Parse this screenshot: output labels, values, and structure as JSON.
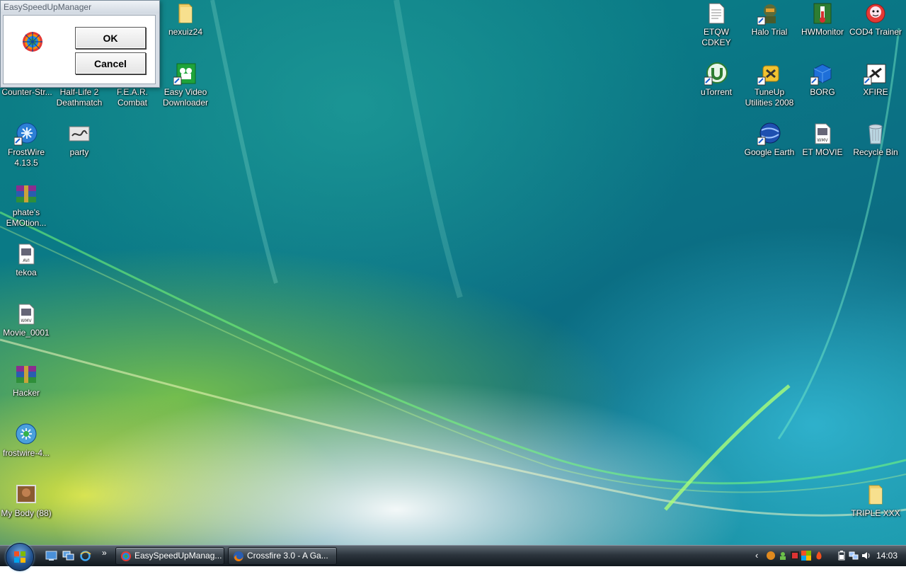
{
  "dialog": {
    "title": "EasySpeedUpManager",
    "ok_label": "OK",
    "cancel_label": "Cancel"
  },
  "desktop": {
    "left_icons": [
      {
        "label": "nexuiz24",
        "icon": "folder-icon"
      },
      {
        "label": "Counter-Str...",
        "icon": "game-icon"
      },
      {
        "label": "Half-Life 2 Deathmatch",
        "icon": "game-icon"
      },
      {
        "label": "F.E.A.R. Combat",
        "icon": "game-icon"
      },
      {
        "label": "Easy Video Downloader",
        "icon": "video-downloader-icon"
      },
      {
        "label": "FrostWire 4.13.5",
        "icon": "frostwire-icon"
      },
      {
        "label": "party",
        "icon": "image-file-icon"
      },
      {
        "label": "phate's EMOtion...",
        "icon": "winrar-archive-icon"
      },
      {
        "label": "tekoa",
        "icon": "avi-file-icon"
      },
      {
        "label": "Movie_0001",
        "icon": "wmv-file-icon"
      },
      {
        "label": "Hacker",
        "icon": "winrar-archive-icon"
      },
      {
        "label": "frostwire-4...",
        "icon": "frostwire-icon"
      },
      {
        "label": "My Body (88)",
        "icon": "photo-thumbnail-icon"
      }
    ],
    "right_icons": [
      {
        "label": "ETQW CDKEY",
        "icon": "text-document-icon"
      },
      {
        "label": "Halo Trial",
        "icon": "halo-icon"
      },
      {
        "label": "HWMonitor",
        "icon": "hwmonitor-icon"
      },
      {
        "label": "COD4 Trainer",
        "icon": "trainer-icon"
      },
      {
        "label": "uTorrent",
        "icon": "utorrent-icon"
      },
      {
        "label": "TuneUp Utilities 2008",
        "icon": "tuneup-icon"
      },
      {
        "label": "BORG",
        "icon": "cube-icon"
      },
      {
        "label": "XFIRE",
        "icon": "xfire-icon"
      },
      {
        "label": "Google Earth",
        "icon": "globe-icon"
      },
      {
        "label": "ET MOVIE",
        "icon": "wmv-file-icon"
      },
      {
        "label": "Recycle Bin",
        "icon": "recycle-bin-icon"
      },
      {
        "label": "TRIPLE XXX",
        "icon": "folder-icon"
      }
    ]
  },
  "taskbar": {
    "quick_launch": [
      "show-desktop-icon",
      "switch-windows-icon",
      "internet-explorer-icon"
    ],
    "overflow_chevron": "»",
    "tasks": [
      {
        "label": "EasySpeedUpManag...",
        "icon": "easyspeedup-icon"
      },
      {
        "label": "Crossfire 3.0 - A Ga...",
        "icon": "firefox-icon"
      }
    ],
    "tray_chevron": "‹",
    "clock": "14:03",
    "colors": {
      "taskbar_top": "#5b6670",
      "taskbar_bottom": "#10171d"
    }
  }
}
